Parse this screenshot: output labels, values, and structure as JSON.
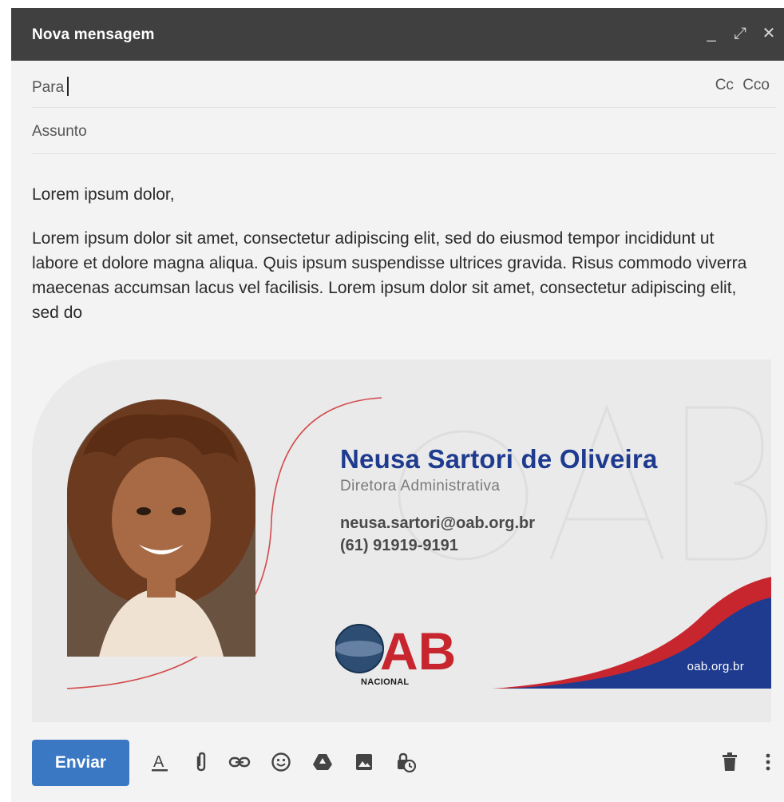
{
  "window": {
    "title": "Nova mensagem",
    "controls": {
      "minimize": "_",
      "expand": "⤢",
      "close": "✕"
    }
  },
  "to_field": {
    "label": "Para",
    "cc": "Cc",
    "bcc": "Cco"
  },
  "subject_field": {
    "label": "Assunto"
  },
  "message": {
    "greeting": "Lorem ipsum dolor,",
    "paragraph": "Lorem ipsum dolor sit amet, consectetur adipiscing elit, sed do eiusmod tempor incididunt ut labore et dolore magna aliqua. Quis ipsum suspendisse ultrices gravida. Risus commodo viverra maecenas accumsan lacus vel facilisis. Lorem ipsum dolor sit amet, consectetur adipiscing elit, sed do"
  },
  "signature": {
    "name": "Neusa Sartori de Oliveira",
    "role": "Diretora Administrativa",
    "email": "neusa.sartori@oab.org.br",
    "phone": "(61) 91919-9191",
    "logo_text": "AB",
    "logo_subtitle": "NACIONAL",
    "website": "oab.org.br",
    "colors": {
      "navy": "#1f3b8f",
      "red": "#c8262e",
      "gray": "#7a7a7a"
    }
  },
  "toolbar": {
    "send_label": "Enviar",
    "icons": [
      "format-text-icon",
      "attach-icon",
      "link-icon",
      "emoji-icon",
      "drive-icon",
      "image-icon",
      "confidential-icon",
      "trash-icon",
      "more-options-icon"
    ]
  }
}
